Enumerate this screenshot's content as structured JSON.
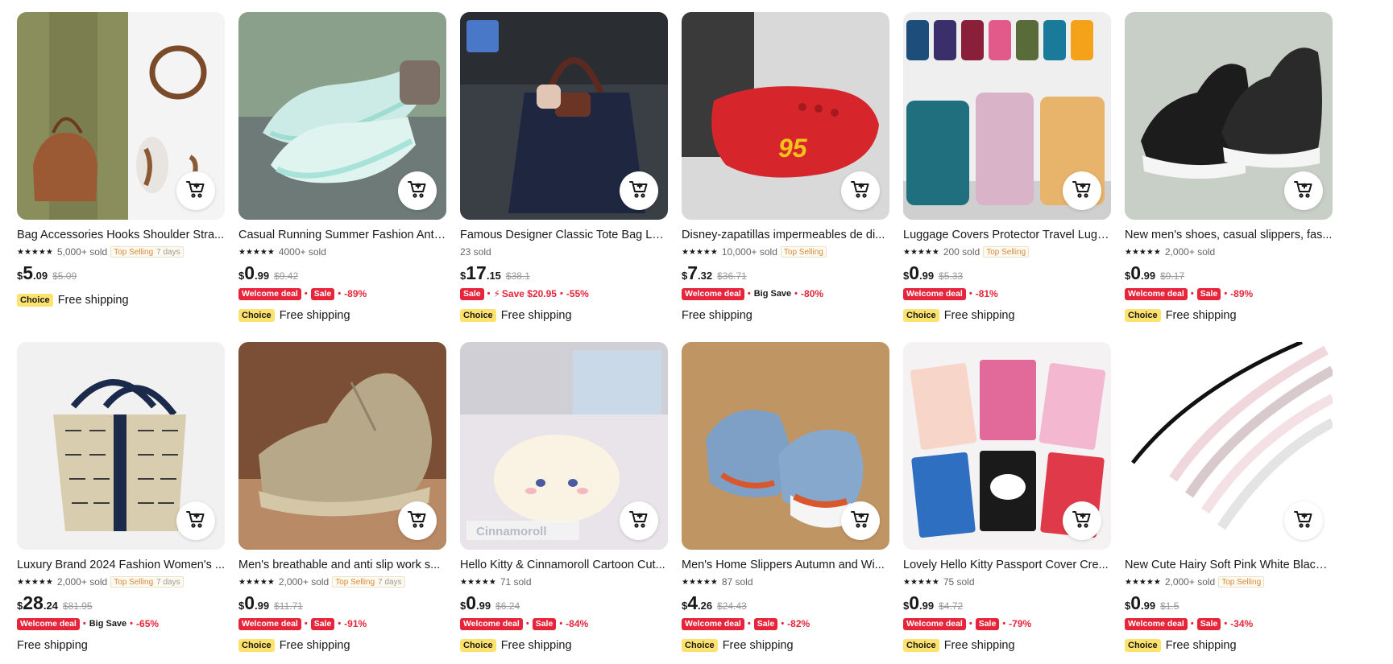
{
  "icons": {
    "cart": "add-to-cart-icon",
    "star": "star-icon"
  },
  "colors": {
    "deal_red": "#e6253b",
    "choice_yellow": "#fde36d",
    "text": "#191919"
  },
  "products": [
    {
      "title": "Bag Accessories Hooks Shoulder Stra...",
      "rating": "★★★★★",
      "sold": "5,000+ sold",
      "tag": "Top Selling",
      "tag_days": "7 days",
      "currency": "$",
      "price_int": "5",
      "price_dec": ".09",
      "old_price": "$5.09",
      "deal1": "",
      "deal2": "",
      "extra": "",
      "discount": "",
      "choice": "Choice",
      "shipping": "Free shipping"
    },
    {
      "title": "Casual Running Summer Fashion Anti-...",
      "rating": "★★★★★",
      "sold": "4000+ sold",
      "tag": "",
      "tag_days": "",
      "currency": "$",
      "price_int": "0",
      "price_dec": ".99",
      "old_price": "$9.42",
      "deal1": "Welcome deal",
      "deal2": "Sale",
      "extra": "",
      "discount": "-89%",
      "choice": "Choice",
      "shipping": "Free shipping"
    },
    {
      "title": "Famous Designer Classic Tote Bag Lo...",
      "rating": "",
      "sold": "23 sold",
      "tag": "",
      "tag_days": "",
      "currency": "$",
      "price_int": "17",
      "price_dec": ".15",
      "old_price": "$38.1",
      "deal1": "Sale",
      "deal2": "",
      "extra": "Save $20.95",
      "discount": "-55%",
      "choice": "Choice",
      "shipping": "Free shipping"
    },
    {
      "title": "Disney-zapatillas impermeables de di...",
      "rating": "★★★★★",
      "sold": "10,000+ sold",
      "tag": "Top Selling",
      "tag_days": "",
      "currency": "$",
      "price_int": "7",
      "price_dec": ".32",
      "old_price": "$36.71",
      "deal1": "Welcome deal",
      "deal2": "",
      "extra": "Big Save",
      "discount": "-80%",
      "choice": "",
      "shipping": "Free shipping"
    },
    {
      "title": "Luggage Covers Protector Travel Lugg...",
      "rating": "★★★★★",
      "sold": "200 sold",
      "tag": "Top Selling",
      "tag_days": "",
      "currency": "$",
      "price_int": "0",
      "price_dec": ".99",
      "old_price": "$5.33",
      "deal1": "Welcome deal",
      "deal2": "",
      "extra": "",
      "discount": "-81%",
      "choice": "Choice",
      "shipping": "Free shipping"
    },
    {
      "title": "New men's shoes, casual slippers, fas...",
      "rating": "★★★★★",
      "sold": "2,000+ sold",
      "tag": "",
      "tag_days": "",
      "currency": "$",
      "price_int": "0",
      "price_dec": ".99",
      "old_price": "$9.17",
      "deal1": "Welcome deal",
      "deal2": "Sale",
      "extra": "",
      "discount": "-89%",
      "choice": "Choice",
      "shipping": "Free shipping"
    },
    {
      "title": "Luxury Brand 2024 Fashion Women's ...",
      "rating": "★★★★★",
      "sold": "2,000+ sold",
      "tag": "Top Selling",
      "tag_days": "7 days",
      "currency": "$",
      "price_int": "28",
      "price_dec": ".24",
      "old_price": "$81.95",
      "deal1": "Welcome deal",
      "deal2": "",
      "extra": "Big Save",
      "discount": "-65%",
      "choice": "",
      "shipping": "Free shipping"
    },
    {
      "title": "Men's breathable and anti slip work s...",
      "rating": "★★★★★",
      "sold": "2,000+ sold",
      "tag": "Top Selling",
      "tag_days": "7 days",
      "currency": "$",
      "price_int": "0",
      "price_dec": ".99",
      "old_price": "$11.71",
      "deal1": "Welcome deal",
      "deal2": "Sale",
      "extra": "",
      "discount": "-91%",
      "choice": "Choice",
      "shipping": "Free shipping"
    },
    {
      "title": "Hello Kitty & Cinnamoroll Cartoon Cut...",
      "rating": "★★★★★",
      "sold": "71 sold",
      "tag": "",
      "tag_days": "",
      "currency": "$",
      "price_int": "0",
      "price_dec": ".99",
      "old_price": "$6.24",
      "deal1": "Welcome deal",
      "deal2": "Sale",
      "extra": "",
      "discount": "-84%",
      "choice": "Choice",
      "shipping": "Free shipping"
    },
    {
      "title": "Men's Home Slippers Autumn and Wi...",
      "rating": "★★★★★",
      "sold": "87 sold",
      "tag": "",
      "tag_days": "",
      "currency": "$",
      "price_int": "4",
      "price_dec": ".26",
      "old_price": "$24.43",
      "deal1": "Welcome deal",
      "deal2": "Sale",
      "extra": "",
      "discount": "-82%",
      "choice": "Choice",
      "shipping": "Free shipping"
    },
    {
      "title": "Lovely Hello Kitty Passport Cover Cre...",
      "rating": "★★★★★",
      "sold": "75 sold",
      "tag": "",
      "tag_days": "",
      "currency": "$",
      "price_int": "0",
      "price_dec": ".99",
      "old_price": "$4.72",
      "deal1": "Welcome deal",
      "deal2": "Sale",
      "extra": "",
      "discount": "-79%",
      "choice": "Choice",
      "shipping": "Free shipping"
    },
    {
      "title": "New Cute Hairy Soft Pink White Black ...",
      "rating": "★★★★★",
      "sold": "2,000+ sold",
      "tag": "Top Selling",
      "tag_days": "",
      "currency": "$",
      "price_int": "0",
      "price_dec": ".99",
      "old_price": "$1.5",
      "deal1": "Welcome deal",
      "deal2": "Sale",
      "extra": "",
      "discount": "-34%",
      "choice": "Choice",
      "shipping": "Free shipping"
    }
  ],
  "image_texts": {
    "cinnamoroll_label": "Cinnamoroll"
  }
}
